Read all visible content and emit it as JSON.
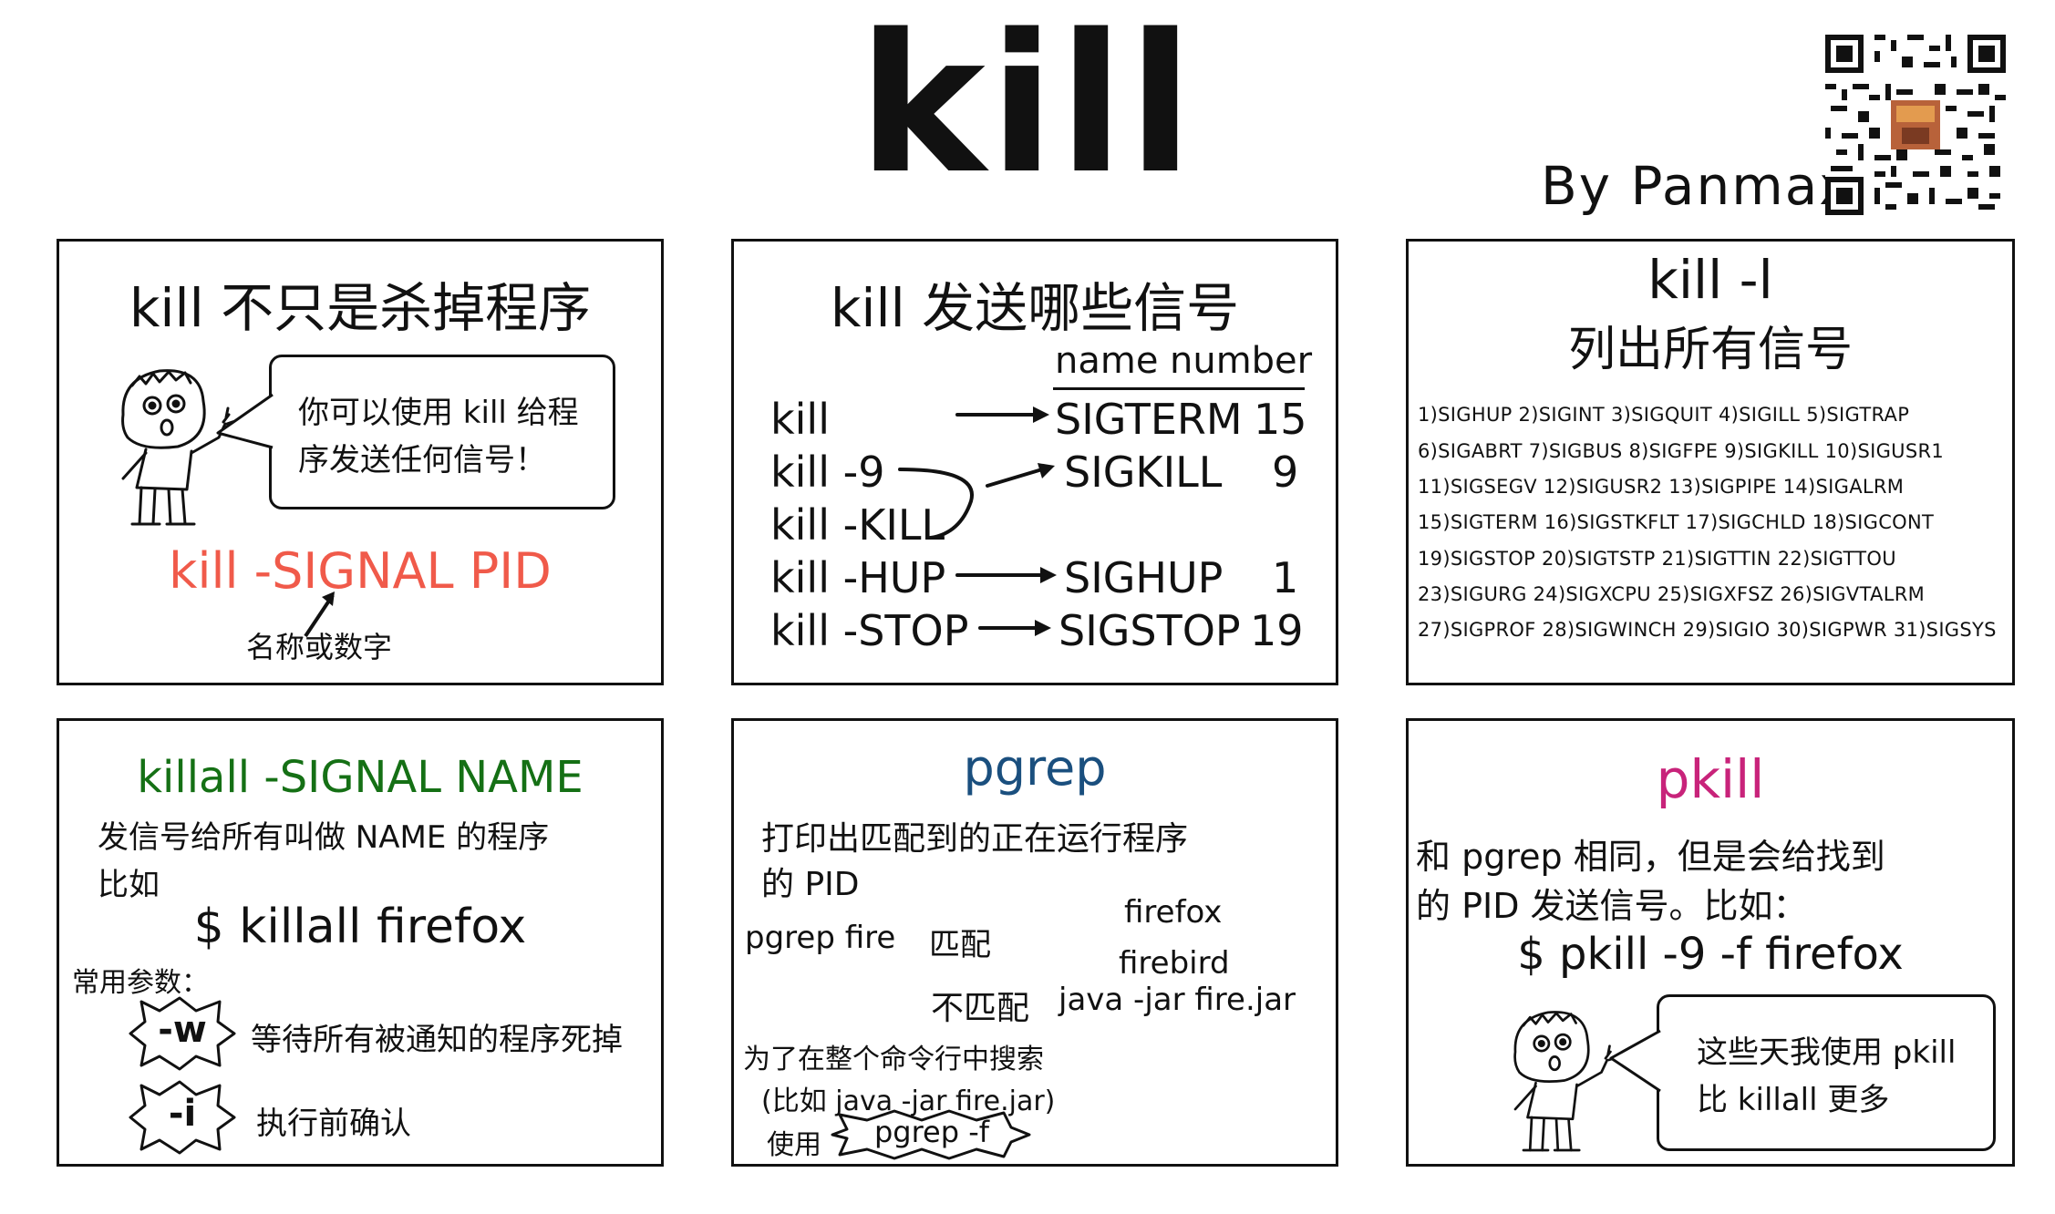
{
  "header": {
    "title": "kill",
    "byline": "By Panmax"
  },
  "colors": {
    "red": "#f05a4a",
    "green": "#157015",
    "blue": "#1a4f7e",
    "magenta": "#c8237a",
    "ink": "#111111"
  },
  "panel1": {
    "title": "kill 不只是杀掉程序",
    "bubble_line1": "你可以使用 kill 给程",
    "bubble_line2": "序发送任何信号！",
    "syntax": "kill -SIGNAL PID",
    "note": "名称或数字"
  },
  "panel2": {
    "title": "kill 发送哪些信号",
    "col_name": "name",
    "col_number": "number",
    "commands": [
      "kill",
      "kill -9",
      "kill -KILL",
      "kill -HUP",
      "kill -STOP"
    ],
    "signals": [
      {
        "name": "SIGTERM",
        "number": "15"
      },
      {
        "name": "SIGKILL",
        "number": "9"
      },
      {
        "name": "SIGHUP",
        "number": "1"
      },
      {
        "name": "SIGSTOP",
        "number": "19"
      }
    ]
  },
  "panel3": {
    "title": "kill -l",
    "subtitle": "列出所有信号",
    "lines": [
      "1)SIGHUP  2)SIGINT  3)SIGQUIT  4)SIGILL  5)SIGTRAP",
      "6)SIGABRT  7)SIGBUS  8)SIGFPE  9)SIGKILL  10)SIGUSR1",
      "11)SIGSEGV  12)SIGUSR2  13)SIGPIPE  14)SIGALRM",
      "15)SIGTERM 16)SIGSTKFLT  17)SIGCHLD  18)SIGCONT",
      " 19)SIGSTOP  20)SIGTSTP 21)SIGTTIN  22)SIGTTOU",
      "23)SIGURG  24)SIGXCPU  25)SIGXFSZ 26)SIGVTALRM",
      "27)SIGPROF  28)SIGWINCH  29)SIGIO  30)SIGPWR 31)SIGSYS"
    ]
  },
  "panel4": {
    "title": "killall -SIGNAL NAME",
    "desc1": "发信号给所有叫做 NAME 的程序",
    "desc2": "比如",
    "example": "$ killall firefox",
    "params_label": "常用参数：",
    "params": [
      {
        "flag": "-w",
        "desc": "等待所有被通知的程序死掉"
      },
      {
        "flag": "-i",
        "desc": "执行前确认"
      }
    ]
  },
  "panel5": {
    "title": "pgrep",
    "desc1": "打印出匹配到的正在运行程序",
    "desc2": "的 PID",
    "cmd": "pgrep fire",
    "match_label": "匹配",
    "match1": "firefox",
    "match2": "firebird",
    "nomatch_label": "不匹配",
    "nomatch": "java -jar fire.jar",
    "search1": "为了在整个命令行中搜索",
    "search2": "(比如 java -jar fire.jar)",
    "use_label": "使用",
    "flag": "pgrep -f"
  },
  "panel6": {
    "title": "pkill",
    "desc1": "和 pgrep 相同，但是会给找到",
    "desc2": "的 PID 发送信号。比如：",
    "example": "$ pkill -9 -f firefox",
    "bubble_line1": "这些天我使用 pkill",
    "bubble_line2": "比 killall 更多"
  }
}
